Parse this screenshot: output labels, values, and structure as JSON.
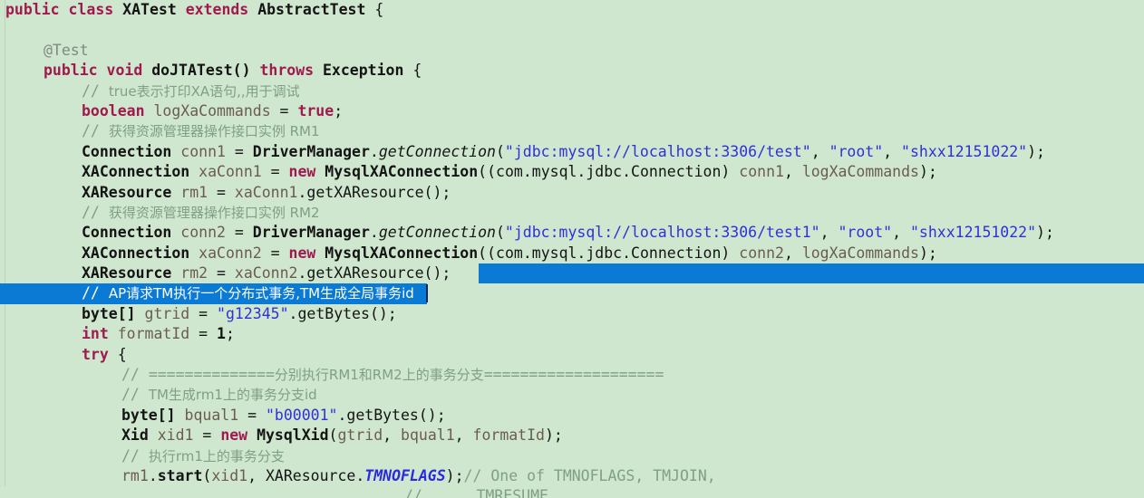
{
  "editor": {
    "language": "java",
    "background_color": "#cfe7cf",
    "selection_color": "#0a7ad4",
    "selected_text_color": "#ffffff",
    "keyword_color": "#a01a4e",
    "string_color": "#3030d8",
    "comment_color": "#7f9f86",
    "variable_color": "#6b5c4e"
  },
  "code": {
    "l1": {
      "kw1": "public",
      "sp1": " ",
      "kw2": "class",
      "sp2": " ",
      "name": "XATest",
      "sp3": " ",
      "kw3": "extends",
      "sp4": " ",
      "super": "AbstractTest",
      "brace": " {"
    },
    "l2": "",
    "l3": {
      "annotation": "@Test"
    },
    "l4": {
      "kw1": "public",
      "sp1": " ",
      "kw2": "void",
      "sp2": " ",
      "method": "doJTATest()",
      "sp3": " ",
      "kw3": "throws",
      "sp4": " ",
      "ex": "Exception",
      "brace": " {"
    },
    "l5": {
      "slashes": "// ",
      "text": "true表示打印XA语句,,用于调试"
    },
    "l6": {
      "kw": "boolean",
      "sp1": " ",
      "var": "logXaCommands",
      "eq": " = ",
      "kw2": "true",
      "semi": ";"
    },
    "l7": {
      "slashes": "// ",
      "text": "获得资源管理器操作接口实例 RM1"
    },
    "l8": {
      "type": "Connection",
      "sp1": " ",
      "var": "conn1",
      "eq": " = ",
      "cls": "DriverManager",
      "dot": ".",
      "method": "getConnection",
      "open": "(",
      "s1": "\"jdbc:mysql://localhost:3306/test\"",
      "c1": ", ",
      "s2": "\"root\"",
      "c2": ", ",
      "s3": "\"shxx12151022\"",
      "close": ");"
    },
    "l9": {
      "type": "XAConnection",
      "sp1": " ",
      "var": "xaConn1",
      "eq": " = ",
      "kw": "new",
      "sp2": " ",
      "cls": "MysqlXAConnection",
      "open": "((",
      "cast": "com.mysql.jdbc.Connection",
      "close1": ") ",
      "a1": "conn1",
      "c1": ", ",
      "a2": "logXaCommands",
      "close2": ");"
    },
    "l10": {
      "type": "XAResource",
      "sp1": " ",
      "var": "rm1",
      "eq": " = ",
      "obj": "xaConn1",
      "dot": ".",
      "method": "getXAResource",
      "close": "();"
    },
    "l11": {
      "slashes": "// ",
      "text": "获得资源管理器操作接口实例 RM2"
    },
    "l12": {
      "type": "Connection",
      "sp1": " ",
      "var": "conn2",
      "eq": " = ",
      "cls": "DriverManager",
      "dot": ".",
      "method": "getConnection",
      "open": "(",
      "s1": "\"jdbc:mysql://localhost:3306/test1\"",
      "c1": ", ",
      "s2": "\"root\"",
      "c2": ", ",
      "s3": "\"shxx12151022\"",
      "close": ");"
    },
    "l13": {
      "type": "XAConnection",
      "sp1": " ",
      "var": "xaConn2",
      "eq": " = ",
      "kw": "new",
      "sp2": " ",
      "cls": "MysqlXAConnection",
      "open": "((",
      "cast": "com.mysql.jdbc.Connection",
      "close1": ") ",
      "a1": "conn2",
      "c1": ", ",
      "a2": "logXaCommands",
      "close2": ");"
    },
    "l14": {
      "type": "XAResource",
      "sp1": " ",
      "var": "rm2",
      "eq": " = ",
      "obj": "xaConn2",
      "dot": ".",
      "method": "getXAResource",
      "close": "();"
    },
    "l15_selected": {
      "slashes": "// ",
      "text": "AP请求TM执行一个分布式事务,TM生成全局事务id"
    },
    "l16": {
      "type": "byte[]",
      "sp1": " ",
      "var": "gtrid",
      "eq": " = ",
      "s1": "\"g12345\"",
      "dot": ".",
      "method": "getBytes",
      "close": "();"
    },
    "l17": {
      "kw": "int",
      "sp1": " ",
      "var": "formatId",
      "eq": " = ",
      "num": "1",
      "semi": ";"
    },
    "l18": {
      "kw": "try",
      "brace": " {"
    },
    "l19": {
      "slashes": "// ",
      "eq_left": "==============",
      "text": "分别执行RM1和RM2上的事务分支",
      "eq_right": "===================="
    },
    "l20": {
      "slashes": "// ",
      "text": "TM生成rm1上的事务分支id"
    },
    "l21": {
      "type": "byte[]",
      "sp1": " ",
      "var": "bqual1",
      "eq": " = ",
      "s1": "\"b00001\"",
      "dot": ".",
      "method": "getBytes",
      "close": "();"
    },
    "l22": {
      "type": "Xid",
      "sp1": " ",
      "var": "xid1",
      "eq": " = ",
      "kw": "new",
      "sp2": " ",
      "cls": "MysqlXid",
      "open": "(",
      "a1": "gtrid",
      "c1": ", ",
      "a2": "bqual1",
      "c2": ", ",
      "a3": "formatId",
      "close": ");"
    },
    "l23": {
      "slashes": "// ",
      "text": "执行rm1上的事务分支"
    },
    "l24": {
      "obj": "rm1",
      "dot": ".",
      "method": "start",
      "open": "(",
      "a1": "xid1",
      "c1": ", ",
      "cls": "XAResource",
      "dot2": ".",
      "field": "TMNOFLAGS",
      "close": ");",
      "comment": "// One of TMNOFLAGS, TMJOIN,"
    },
    "l25": {
      "comment": "//      TMRESUME"
    }
  }
}
